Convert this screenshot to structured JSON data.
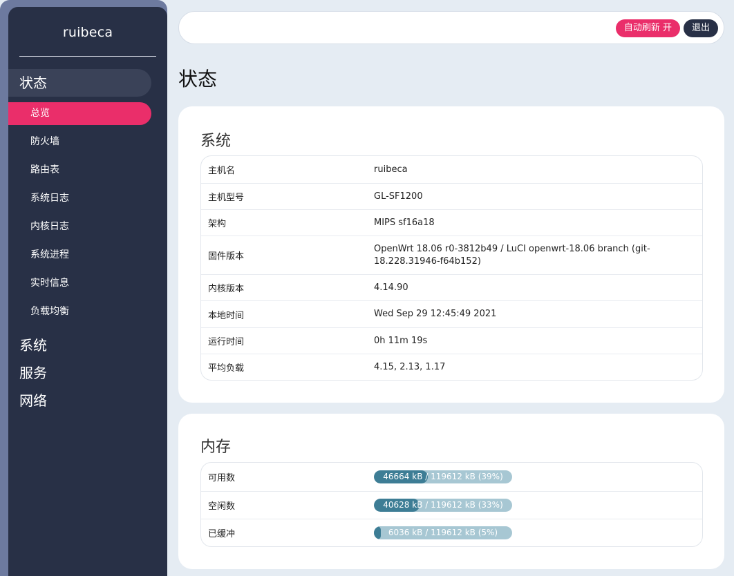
{
  "sidebar": {
    "brand": "ruibeca",
    "categories": [
      {
        "label": "状态",
        "active": true
      },
      {
        "label": "系统"
      },
      {
        "label": "服务"
      },
      {
        "label": "网络"
      }
    ],
    "status_items": [
      {
        "label": "总览",
        "active": true
      },
      {
        "label": "防火墙"
      },
      {
        "label": "路由表"
      },
      {
        "label": "系统日志"
      },
      {
        "label": "内核日志"
      },
      {
        "label": "系统进程"
      },
      {
        "label": "实时信息"
      },
      {
        "label": "负载均衡"
      }
    ]
  },
  "topbar": {
    "refresh_label": "自动刷新 开",
    "logout_label": "退出"
  },
  "page": {
    "title": "状态"
  },
  "system": {
    "title": "系统",
    "rows": [
      {
        "key": "主机名",
        "value": "ruibeca"
      },
      {
        "key": "主机型号",
        "value": "GL-SF1200"
      },
      {
        "key": "架构",
        "value": "MIPS sf16a18"
      },
      {
        "key": "固件版本",
        "value": "OpenWrt 18.06 r0-3812b49 / LuCI openwrt-18.06 branch (git-18.228.31946-f64b152)"
      },
      {
        "key": "内核版本",
        "value": "4.14.90"
      },
      {
        "key": "本地时间",
        "value": "Wed Sep 29 12:45:49 2021"
      },
      {
        "key": "运行时间",
        "value": "0h 11m 19s"
      },
      {
        "key": "平均负载",
        "value": "4.15, 2.13, 1.17"
      }
    ]
  },
  "memory": {
    "title": "内存",
    "rows": [
      {
        "key": "可用数",
        "value": "46664 kB / 119612 kB (39%)",
        "percent": 39
      },
      {
        "key": "空闲数",
        "value": "40628 kB / 119612 kB (33%)",
        "percent": 33
      },
      {
        "key": "已缓冲",
        "value": "6036 kB / 119612 kB (5%)",
        "percent": 5
      }
    ]
  },
  "colors": {
    "accent": "#ea2e6a",
    "sidebar": "#283046",
    "progress_fill": "#3d7d95",
    "progress_track": "#a7c7d3"
  }
}
